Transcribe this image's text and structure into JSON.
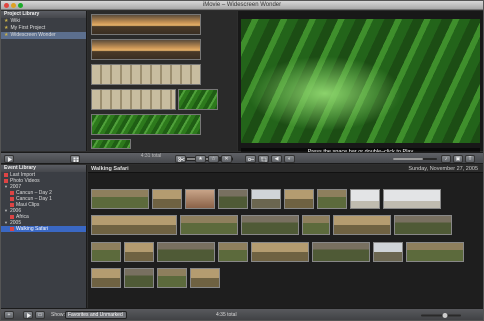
{
  "window": {
    "title": "iMovie – Widescreen Wonder"
  },
  "project_library": {
    "header": "Project Library",
    "items": [
      {
        "label": "Wiki"
      },
      {
        "label": "My First Project"
      },
      {
        "label": "Widescreen Wonder",
        "selected": true
      }
    ]
  },
  "project_browser": {
    "total": "4:31 total"
  },
  "viewer": {
    "caption": "Press the space bar or double–click to Play"
  },
  "event_library": {
    "header": "Event Library",
    "items": [
      {
        "label": "Last Import",
        "level": 0
      },
      {
        "label": "Photo Videos",
        "level": 0
      },
      {
        "label": "2007",
        "level": 0,
        "tri": true
      },
      {
        "label": "Cancun – Day 2",
        "level": 1
      },
      {
        "label": "Cancun – Day 1",
        "level": 1
      },
      {
        "label": "Maui Clips",
        "level": 1
      },
      {
        "label": "2006",
        "level": 0,
        "tri": true
      },
      {
        "label": "Africa",
        "level": 1
      },
      {
        "label": "2005",
        "level": 0,
        "tri": true
      },
      {
        "label": "Walking Safari",
        "level": 1,
        "selected": true
      }
    ]
  },
  "event_browser": {
    "title": "Walking Safari",
    "date": "Sunday, November 27, 2005",
    "total": "4:35 total"
  },
  "bottom_bar": {
    "show_label": "Show:",
    "show_value": "Favorites and Unmarked"
  },
  "colors": {
    "selection": "#3a68c4",
    "project_selection": "#5c6f8e",
    "pane_background": "#3b3e44"
  }
}
